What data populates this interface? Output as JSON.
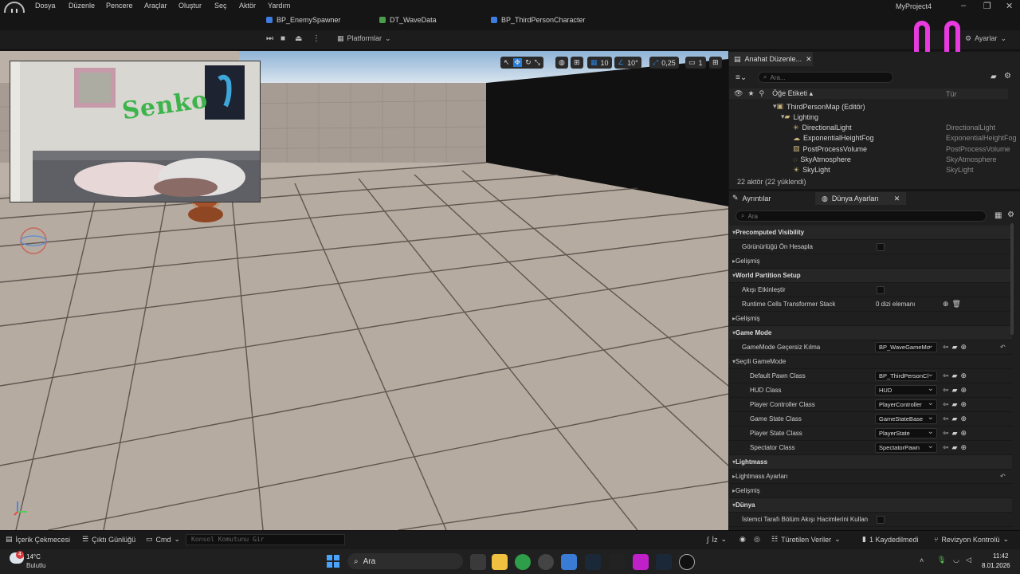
{
  "menu": [
    "Dosya",
    "Düzenle",
    "Pencere",
    "Araçlar",
    "Oluştur",
    "Seç",
    "Aktör",
    "Yardım"
  ],
  "project_name": "MyProject4",
  "tabs": [
    "BP_EnemySpawner",
    "DT_WaveData",
    "BP_ThirdPersonCharacter"
  ],
  "toolbar": {
    "platforms": "Platformlar",
    "settings": "Ayarlar"
  },
  "viewport_tools": {
    "grid_value": "10",
    "angle_value": "10°",
    "scale_value": "0,25",
    "camera_speed": "1"
  },
  "webcam_text": "Senko",
  "outliner": {
    "tab_label": "Anahat Düzenle...",
    "search_placeholder": "Ara...",
    "col_label": "Öğe Etiketi ▴",
    "col_type": "Tür",
    "rows": [
      {
        "label": "ThirdPersonMap (Editör)",
        "type": ""
      },
      {
        "label": "Lighting",
        "type": ""
      },
      {
        "label": "DirectionalLight",
        "type": "DirectionalLight"
      },
      {
        "label": "ExponentialHeightFog",
        "type": "ExponentialHeightFog"
      },
      {
        "label": "PostProcessVolume",
        "type": "PostProcessVolume"
      },
      {
        "label": "SkyAtmosphere",
        "type": "SkyAtmosphere"
      },
      {
        "label": "SkyLight",
        "type": "SkyLight"
      }
    ],
    "status": "22 aktör (22 yüklendi)"
  },
  "details": {
    "tab_details": "Ayrıntılar",
    "tab_world": "Dünya Ayarları",
    "search_placeholder": "Ara",
    "rows": [
      {
        "kind": "section",
        "label": "Precomputed Visibility"
      },
      {
        "kind": "check",
        "label": "Görünürlüğü Ön Hesapla"
      },
      {
        "kind": "sub",
        "label": "Gelişmiş"
      },
      {
        "kind": "section",
        "label": "World Partition Setup"
      },
      {
        "kind": "check",
        "label": "Akışı Etkinleştir"
      },
      {
        "kind": "text",
        "label": "Runtime Cells Transformer Stack",
        "value": "0 dizi elemanı"
      },
      {
        "kind": "sub",
        "label": "Gelişmiş"
      },
      {
        "kind": "section",
        "label": "Game Mode"
      },
      {
        "kind": "ddl",
        "label": "GameMode Geçersiz Kılma",
        "value": "BP_WaveGameMo"
      },
      {
        "kind": "sub",
        "label": "Seçili GameMode"
      },
      {
        "kind": "ddl2",
        "label": "Default Pawn Class",
        "value": "BP_ThirdPersonCl"
      },
      {
        "kind": "ddl2",
        "label": "HUD Class",
        "value": "HUD"
      },
      {
        "kind": "ddl2",
        "label": "Player Controller Class",
        "value": "PlayerController"
      },
      {
        "kind": "ddl2",
        "label": "Game State Class",
        "value": "GameStateBase"
      },
      {
        "kind": "ddl2",
        "label": "Player State Class",
        "value": "PlayerState"
      },
      {
        "kind": "ddl2",
        "label": "Spectator Class",
        "value": "SpectatorPawn"
      },
      {
        "kind": "section",
        "label": "Lightmass"
      },
      {
        "kind": "sub",
        "label": "Lightmass Ayarları"
      },
      {
        "kind": "sub",
        "label": "Gelişmiş"
      },
      {
        "kind": "section",
        "label": "Dünya"
      },
      {
        "kind": "check",
        "label": "İstemci Tarafı Bölüm Akışı Hacimlerini Kullan"
      }
    ]
  },
  "bottom": {
    "content_drawer": "İçerik Çekmecesi",
    "output_log": "Çıktı Günlüğü",
    "cmd": "Cmd",
    "console_placeholder": "Konsol Komutunu Gir",
    "derived_data": "Türetilen Veriler",
    "unsaved": "1 Kaydedilmedi",
    "revision": "Revizyon Kontrolü",
    "iz": "İz"
  },
  "taskbar": {
    "weather_temp": "14°C",
    "weather_desc": "Bulutlu",
    "search": "Ara",
    "time": "11:42",
    "date": "8.01.2026",
    "notif_count": "4"
  },
  "colors": {
    "accent": "#2a7dd6",
    "magenta": "#e83adf",
    "floor": "#b9ada3"
  }
}
